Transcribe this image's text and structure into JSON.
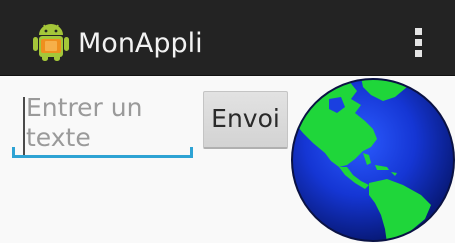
{
  "action_bar": {
    "title": "MonAppli",
    "app_icon": "android-robot-icon",
    "menu_icon": "overflow-menu-icon",
    "background_color": "#232323"
  },
  "form": {
    "text_input": {
      "placeholder": "Entrer un texte",
      "value": ""
    },
    "send_button": {
      "label": "Envoi"
    },
    "accent_color": "#2ea3d4"
  },
  "image": {
    "icon": "globe-icon"
  }
}
